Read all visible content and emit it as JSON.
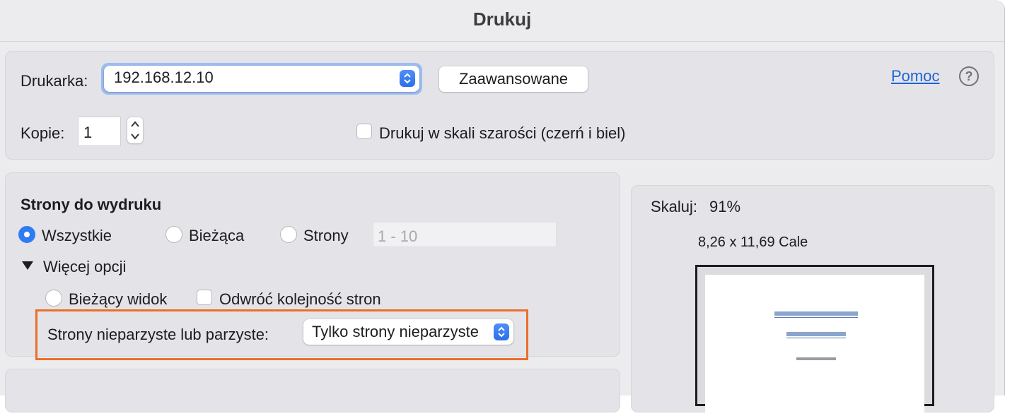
{
  "dialog": {
    "title": "Drukuj"
  },
  "printer": {
    "label": "Drukarka:",
    "value": "192.168.12.10",
    "advanced_button": "Zaawansowane",
    "help_link": "Pomoc",
    "help_icon": "question-mark-circle-icon"
  },
  "copies": {
    "label": "Kopie:",
    "value": "1",
    "grayscale_label": "Drukuj w skali szarości (czerń i biel)",
    "grayscale_checked": false
  },
  "pages": {
    "heading": "Strony do wydruku",
    "options": [
      {
        "label": "Wszystkie",
        "selected": true
      },
      {
        "label": "Bieżąca",
        "selected": false
      },
      {
        "label": "Strony",
        "selected": false
      }
    ],
    "range_placeholder": "1 - 10",
    "more_options_label": "Więcej opcji",
    "current_view_label": "Bieżący widok",
    "reverse_order_label": "Odwróć kolejność stron",
    "odd_even_label": "Strony nieparzyste lub parzyste:",
    "odd_even_value": "Tylko strony nieparzyste"
  },
  "preview": {
    "scale_label": "Skaluj:",
    "scale_value": "91%",
    "paper_size": "8,26 x 11,69 Cale"
  },
  "colors": {
    "accent": "#2f7bf5",
    "highlight": "#ea6e2a",
    "link": "#1f63d8"
  }
}
